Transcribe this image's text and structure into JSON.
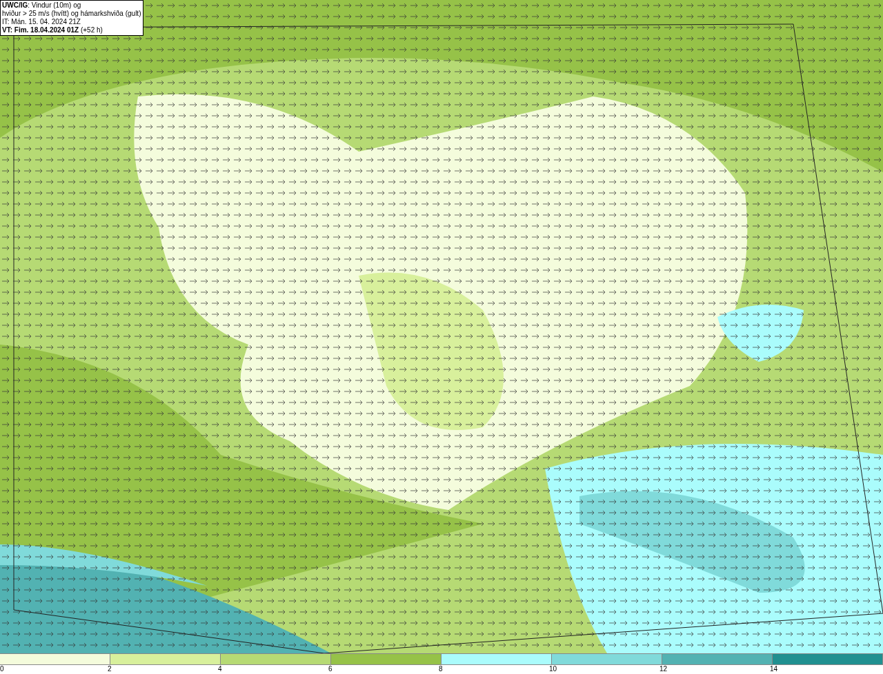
{
  "info_box": {
    "lines": [
      "**UWC/IG**: Vindur (10m) og",
      "hviður > 25 m/s (hvítt) og hámarkshviða (gult)",
      "IT: Mán. 15. 04. 2024 21Z",
      "**VT: Fim. 18.04.2024 01Z** (+52 h)"
    ]
  },
  "legend": {
    "bins": [
      {
        "color": "#f4fcdc"
      },
      {
        "color": "#d8f09c"
      },
      {
        "color": "#b6da74"
      },
      {
        "color": "#96c248"
      },
      {
        "color": "#aafcfc"
      },
      {
        "color": "#80dada"
      },
      {
        "color": "#52b2b2"
      },
      {
        "color": "#209090"
      }
    ],
    "ticks": [
      "0",
      "2",
      "4",
      "6",
      "8",
      "10",
      "12",
      "14"
    ]
  }
}
